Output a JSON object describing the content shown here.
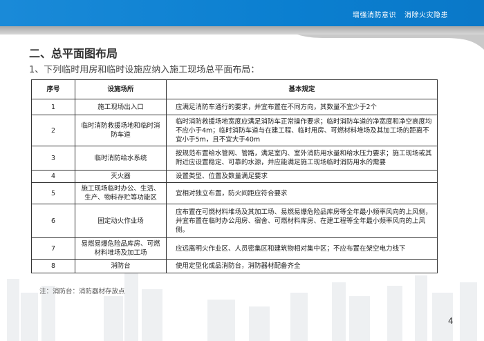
{
  "header": {
    "slogan": [
      "增强消防意识",
      "消除火灾隐患"
    ],
    "brand_color": "#0b7fd0"
  },
  "title": "二、总平面图布局",
  "subtitle": "1、下列临时用房和临时设施应纳入施工现场总平面布局：",
  "table": {
    "headers": [
      "序号",
      "设施场所",
      "基本规定"
    ],
    "rows": [
      {
        "no": "1",
        "place": "施工现场出入口",
        "rule": "应满足消防车通行的要求，并宜布置在不同方向，其数量不宜少于2个"
      },
      {
        "no": "2",
        "place": "临时消防救援场地和临时消防车道",
        "rule": "临时消防救援场地宽度应满足消防车正常操作要求；临时消防车道的净宽度和净空高度均不应小于4m；临时消防车道与在建工程、临时用房、可燃材料堆场及其加工场的距离不宜小于5m，且不宜大于40m"
      },
      {
        "no": "3",
        "place": "临时消防给水系统",
        "rule": "按规范布置给水管网、管路，满足室内、室外消防用水量和给水压力要求；施工现场或其附近应设置稳定、可靠的水源，并应能满足施工现场临时消防用水的需要"
      },
      {
        "no": "4",
        "place": "灭火器",
        "rule": "设置类型、位置及数量满足要求"
      },
      {
        "no": "5",
        "place": "施工现场临时办公、生活、生产、物料存贮等功能区",
        "rule": "宜相对独立布置，防火间距应符合要求"
      },
      {
        "no": "6",
        "place": "固定动火作业场",
        "rule": "应布置在可燃材料堆场及其加工场、易燃易爆危险品库房等全年最小频率风向的上风侧，并宜布置在临时办公用房、宿舍、可燃材料库房、在建工程等全年最小频率风向的上风侧。"
      },
      {
        "no": "7",
        "place": "易燃易爆危险品库房、可燃材料堆场及加工场",
        "rule": "应远离明火作业区、人员密集区和建筑物相对集中区；不应布置在架空电力线下"
      },
      {
        "no": "8",
        "place": "消防台",
        "rule": "使用定型化成品消防台，消防器材配备齐全"
      }
    ]
  },
  "note": "注：消防台：消防器材存放点",
  "page_number": "4"
}
